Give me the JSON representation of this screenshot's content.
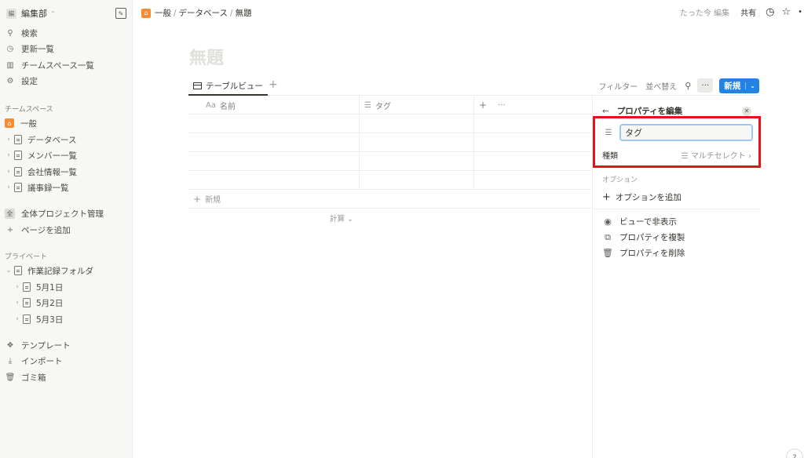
{
  "workspace": {
    "avatar": "編",
    "name": "編集部"
  },
  "sidebar": {
    "top_items": [
      {
        "icon": "search-icon",
        "label": "検索"
      },
      {
        "icon": "clock-icon",
        "label": "更新一覧"
      },
      {
        "icon": "building-icon",
        "label": "チームスペース一覧"
      },
      {
        "icon": "gear-icon",
        "label": "設定"
      }
    ],
    "teamspace_label": "チームスペース",
    "teamspace_home": "一般",
    "teamspace_pages": [
      "データベース",
      "メンバー一覧",
      "会社情報一覧",
      "議事録一覧"
    ],
    "project": {
      "avatar": "全",
      "label": "全体プロジェクト管理"
    },
    "add_page": "ページを追加",
    "private_label": "プライベート",
    "private_folder": "作業記録フォルダ",
    "private_pages": [
      "5月1日",
      "5月2日",
      "5月3日"
    ],
    "bottom_items": [
      {
        "icon": "template-icon",
        "label": "テンプレート"
      },
      {
        "icon": "import-icon",
        "label": "インポート"
      },
      {
        "icon": "trash-icon",
        "label": "ゴミ箱"
      }
    ]
  },
  "breadcrumb": {
    "home": "一般",
    "parent": "データベース",
    "current": "無題"
  },
  "topbar": {
    "edited": "たった今 編集",
    "share": "共有"
  },
  "page": {
    "title": "無題"
  },
  "viewbar": {
    "tab_label": "テーブルビュー",
    "filter": "フィルター",
    "sort": "並べ替え",
    "new_label": "新規"
  },
  "table": {
    "columns": [
      {
        "prefix": "Aa",
        "label": "名前"
      },
      {
        "prefix": "☰",
        "label": "タグ"
      }
    ],
    "add_column": "+",
    "more": "···",
    "new_row": "新規",
    "calc": "計算"
  },
  "property_panel": {
    "title": "プロパティを編集",
    "name_value": "タグ",
    "type_label": "種類",
    "type_value": "マルチセレクト",
    "options_label": "オプション",
    "add_option": "オプションを追加",
    "actions": [
      {
        "icon": "eye-icon",
        "label": "ビューで非表示"
      },
      {
        "icon": "copy-icon",
        "label": "プロパティを複製"
      },
      {
        "icon": "trash-icon",
        "label": "プロパティを削除"
      }
    ]
  },
  "colors": {
    "accent": "#2383e2",
    "highlight": "#e8101b",
    "home": "#f28c38"
  }
}
